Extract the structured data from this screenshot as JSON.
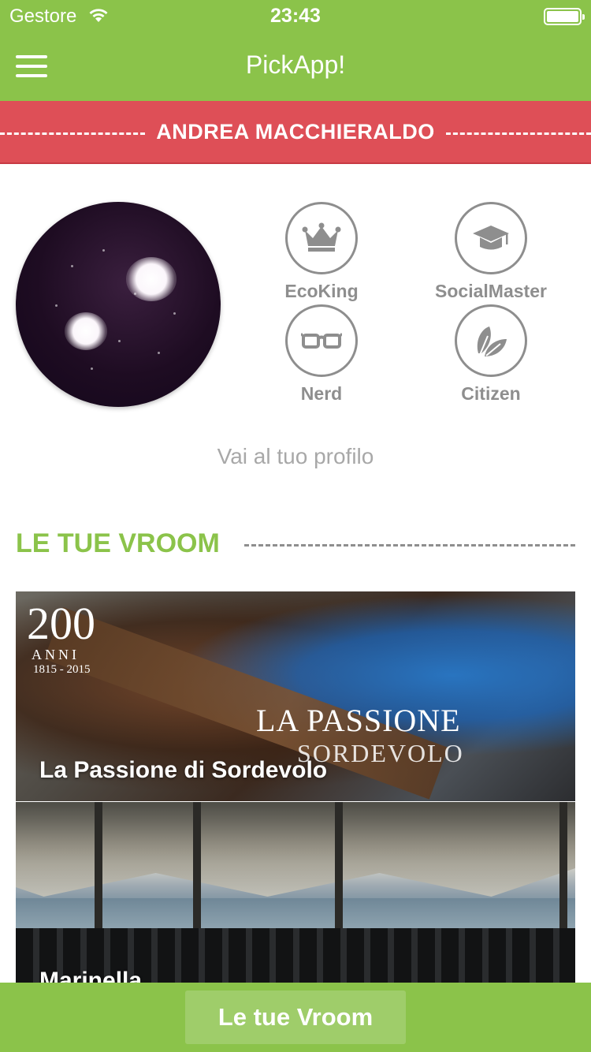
{
  "status_bar": {
    "carrier": "Gestore",
    "time": "23:43"
  },
  "nav": {
    "title": "PickApp!",
    "menu_icon": "hamburger-menu-icon"
  },
  "user": {
    "name": "ANDREA MACCHIERALDO"
  },
  "badges": [
    {
      "label": "EcoKing",
      "icon": "crown-icon"
    },
    {
      "label": "SocialMaster",
      "icon": "graduation-cap-icon"
    },
    {
      "label": "Nerd",
      "icon": "glasses-icon"
    },
    {
      "label": "Citizen",
      "icon": "leaf-icon"
    }
  ],
  "profile_link": "Vai al tuo profilo",
  "section": {
    "title": "LE TUE VROOM"
  },
  "vrooms": [
    {
      "title": "La Passione di Sordevolo",
      "image_text": {
        "big": "200",
        "anni": "ANNI",
        "years": "1815 - 2015",
        "logo_main": "LA PASSIONE",
        "logo_sub": "SORDEVOLO"
      }
    },
    {
      "title": "Marinella"
    }
  ],
  "bottom_button": {
    "label": "Le tue Vroom"
  },
  "colors": {
    "primary_green": "#8bc34a",
    "banner_red": "#de4f57",
    "badge_gray": "#8e8e8e"
  }
}
